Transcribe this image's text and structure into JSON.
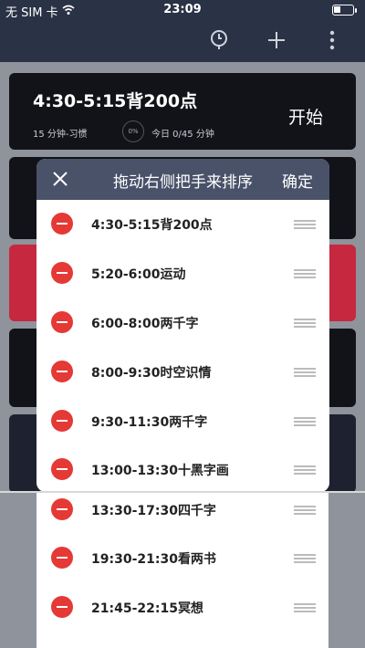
{
  "status": {
    "carrier": "无 SIM 卡",
    "time": "23:09"
  },
  "nav": {
    "icons": [
      "clock-icon",
      "plus-icon",
      "more-icon"
    ]
  },
  "background_list": {
    "first_card": {
      "title": "4:30-5:15背200点",
      "meta": "15 分钟-习惯",
      "percent": "0%",
      "today": "今日 0/45 分钟",
      "start": "开始"
    }
  },
  "sheet": {
    "title": "拖动右侧把手来排序",
    "confirm": "确定",
    "items": [
      {
        "label": "4:30-5:15背200点"
      },
      {
        "label": "5:20-6:00运动"
      },
      {
        "label": "6:00-8:00两千字"
      },
      {
        "label": "8:00-9:30时空识情"
      },
      {
        "label": "9:30-11:30两千字"
      },
      {
        "label": "13:00-13:30十黑字画"
      }
    ]
  },
  "strip": {
    "items": [
      {
        "label": "13:30-17:30四千字"
      },
      {
        "label": "19:30-21:30看两书"
      },
      {
        "label": "21:45-22:15冥想"
      }
    ]
  },
  "colors": {
    "nav": "#2a3245",
    "sheet_header": "#4a526a",
    "delete": "#e53935",
    "accent_card": "#c62840"
  }
}
